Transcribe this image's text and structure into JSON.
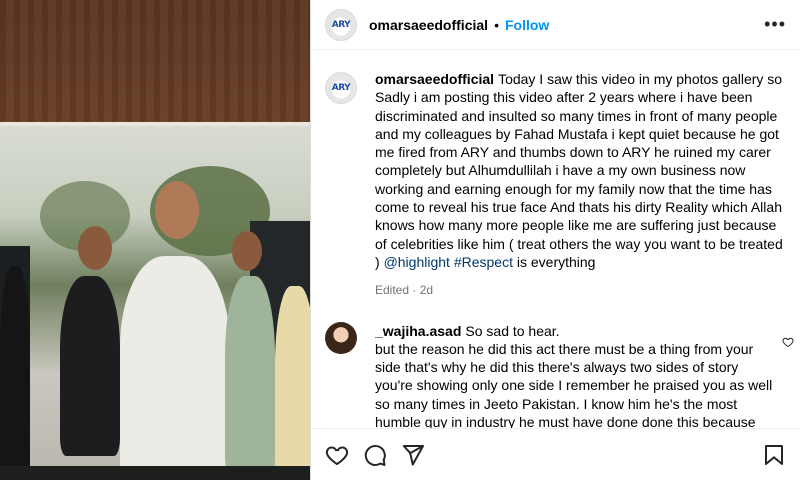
{
  "header": {
    "username": "omarsaeedofficial",
    "separator": "•",
    "follow_label": "Follow",
    "more_label": "•••",
    "avatar_logo": "ARY"
  },
  "post": {
    "username": "omarsaeedofficial",
    "caption": "Today I saw this video in my photos gallery so Sadly i am posting this video after 2 years where i have been discriminated and insulted so many times in front of many people and my colleagues by Fahad Mustafa i kept quiet because he got me fired from ARY and thumbs down to ARY he ruined my carer completely but Alhumdullilah i have a my own business now working and earning enough for my family now that the time has come to reveal his true face And thats his dirty Reality which Allah knows how many more people like me are suffering just because of celebrities like him ( treat others the way you want to be treated )",
    "tag1": "@highlight",
    "tag2": "#Respect",
    "tail": "is everything",
    "meta": "Edited · 2d"
  },
  "comment": {
    "username": "_wajiha.asad",
    "text_first": "So sad to hear.",
    "text_rest": "but the reason he did this act there must be a thing from your side that's why he did this there's always two sides of story you're showing only one side I remember he praised you as well so many times in Jeeto Pakistan. I know him he's the most humble guy in industry he must have done done this because"
  },
  "icons": {
    "like": "heart-icon",
    "comment": "comment-icon",
    "share": "share-icon",
    "save": "bookmark-icon",
    "more": "more-icon"
  },
  "colors": {
    "follow": "#0095f6",
    "tag": "#00376b",
    "muted": "#737373"
  }
}
